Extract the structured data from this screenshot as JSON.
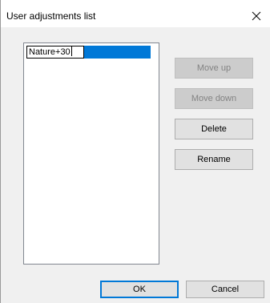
{
  "window": {
    "title": "User adjustments list"
  },
  "list": {
    "items": [
      {
        "label": "Nature+30",
        "selected": true,
        "editing": true
      }
    ]
  },
  "buttons": {
    "move_up": {
      "label": "Move up",
      "enabled": false
    },
    "move_down": {
      "label": "Move down",
      "enabled": false
    },
    "delete": {
      "label": "Delete",
      "enabled": true
    },
    "rename": {
      "label": "Rename",
      "enabled": true
    },
    "ok": {
      "label": "OK",
      "default": true
    },
    "cancel": {
      "label": "Cancel"
    }
  },
  "colors": {
    "selection": "#0078d7",
    "dialog_bg": "#f0f0f0",
    "button_bg": "#e1e1e1",
    "disabled_text": "#838383"
  },
  "icons": {
    "close": "close-icon"
  }
}
